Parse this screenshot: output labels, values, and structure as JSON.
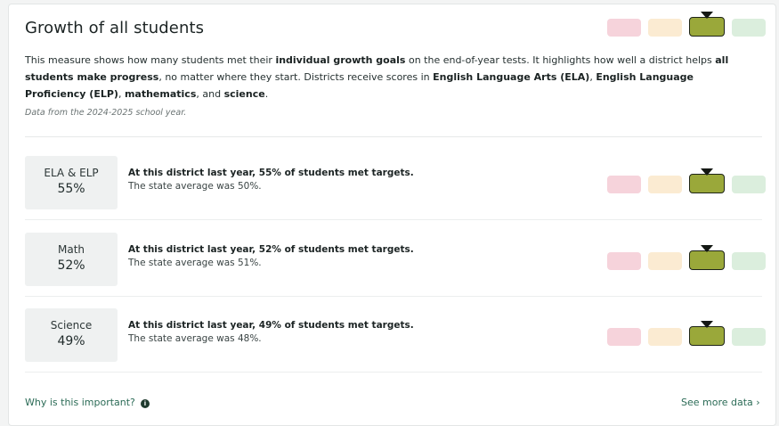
{
  "card": {
    "title": "Growth of all students",
    "description": {
      "parts": [
        {
          "text": "This measure shows how many students met their ",
          "bold": false
        },
        {
          "text": "individual growth goals",
          "bold": true
        },
        {
          "text": " on the end-of-year tests. It highlights how well a district helps ",
          "bold": false
        },
        {
          "text": "all students make progress",
          "bold": true
        },
        {
          "text": ", no matter where they start. Districts receive scores in ",
          "bold": false
        },
        {
          "text": "English Language Arts (ELA)",
          "bold": true
        },
        {
          "text": ", ",
          "bold": false
        },
        {
          "text": "English Language Proficiency (ELP)",
          "bold": true
        },
        {
          "text": ", ",
          "bold": false
        },
        {
          "text": "mathematics",
          "bold": true
        },
        {
          "text": ", and ",
          "bold": false
        },
        {
          "text": "science",
          "bold": true
        },
        {
          "text": ".",
          "bold": false
        }
      ]
    },
    "source": "Data from the 2024-2025 school year.",
    "overall_scale": {
      "selected_index": 2
    }
  },
  "scale_colors": [
    "#f6d3db",
    "#fbebd2",
    "#9aa83a",
    "#dbeedd"
  ],
  "rows": [
    {
      "label": "ELA & ELP",
      "value": "55%",
      "headline": "At this district last year, 55% of students met targets.",
      "subtext": "The state average was 50%.",
      "selected_index": 2
    },
    {
      "label": "Math",
      "value": "52%",
      "headline": "At this district last year, 52% of students met targets.",
      "subtext": "The state average was 51%.",
      "selected_index": 2
    },
    {
      "label": "Science",
      "value": "49%",
      "headline": "At this district last year, 49% of students met targets.",
      "subtext": "The state average was 48%.",
      "selected_index": 2
    }
  ],
  "footer": {
    "why_label": "Why is this important?",
    "info_icon": "info-icon",
    "see_more_label": "See more data ›"
  }
}
